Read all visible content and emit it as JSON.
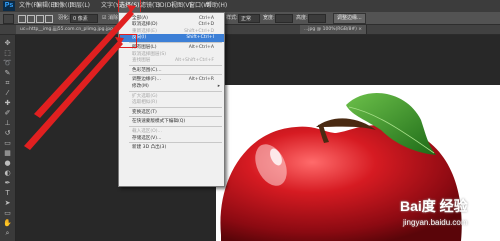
{
  "app": {
    "logo": "Ps"
  },
  "menubar": {
    "items": [
      "文件(F)",
      "编辑(E)",
      "图像(I)",
      "图层(L)",
      "文字(Y)",
      "选择(S)",
      "滤镜(T)",
      "3D(D)",
      "视图(V)",
      "窗口(W)",
      "帮助(H)"
    ],
    "active_index": 5
  },
  "options": {
    "feather_label": "羽化:",
    "feather_value": "0 像素",
    "antialias_label": "消除锯齿",
    "style_label": "样式:",
    "style_value": "正常",
    "width_label": "宽度:",
    "height_label": "高度:",
    "refine_button": "调整边缘..."
  },
  "tabs": [
    {
      "label": "uc=http__img.jjjj55.com.cn_plimg.jpg.jpg..."
    },
    {
      "label": "1291435...jpg @ 100% (RGB/8#) ×"
    },
    {
      "label": "...jpg @ 100%(RGB/8#) ×"
    }
  ],
  "select_menu": {
    "items": [
      {
        "label": "全部(A)",
        "shortcut": "Ctrl+A",
        "disabled": false
      },
      {
        "label": "取消选择(D)",
        "shortcut": "Ctrl+D",
        "disabled": false
      },
      {
        "label": "重新选择(E)",
        "shortcut": "Shift+Ctrl+D",
        "disabled": true
      },
      {
        "label": "反向(I)",
        "shortcut": "Shift+Ctrl+I",
        "disabled": false,
        "highlighted": true
      },
      {
        "sep": true
      },
      {
        "label": "所有图层(L)",
        "shortcut": "Alt+Ctrl+A",
        "disabled": false
      },
      {
        "label": "取消选择图层(S)",
        "shortcut": "",
        "disabled": true
      },
      {
        "label": "查找图层",
        "shortcut": "Alt+Shift+Ctrl+F",
        "disabled": true
      },
      {
        "sep": true
      },
      {
        "label": "色彩范围(C)...",
        "shortcut": "",
        "disabled": false
      },
      {
        "sep": true
      },
      {
        "label": "调整边缘(F)...",
        "shortcut": "Alt+Ctrl+R",
        "disabled": false
      },
      {
        "label": "修改(M)",
        "shortcut": "",
        "disabled": false,
        "submenu": true
      },
      {
        "sep": true
      },
      {
        "label": "扩大选取(G)",
        "shortcut": "",
        "disabled": true
      },
      {
        "label": "选取相似(R)",
        "shortcut": "",
        "disabled": true
      },
      {
        "sep": true
      },
      {
        "label": "变换选区(T)",
        "shortcut": "",
        "disabled": false
      },
      {
        "sep": true
      },
      {
        "label": "在快速蒙版模式下编辑(Q)",
        "shortcut": "",
        "disabled": false
      },
      {
        "sep": true
      },
      {
        "label": "载入选区(O)...",
        "shortcut": "",
        "disabled": true
      },
      {
        "label": "存储选区(V)...",
        "shortcut": "",
        "disabled": false
      },
      {
        "sep": true
      },
      {
        "label": "新建 3D 凸出(3)",
        "shortcut": "",
        "disabled": false
      }
    ]
  },
  "watermark": {
    "brand": "Bai度 经验",
    "url": "jingyan.baidu.com"
  },
  "colors": {
    "highlight": "#3c7fd6",
    "annotation": "#e02020",
    "apple_red": "#c8141e",
    "leaf": "#3f9b2a"
  }
}
